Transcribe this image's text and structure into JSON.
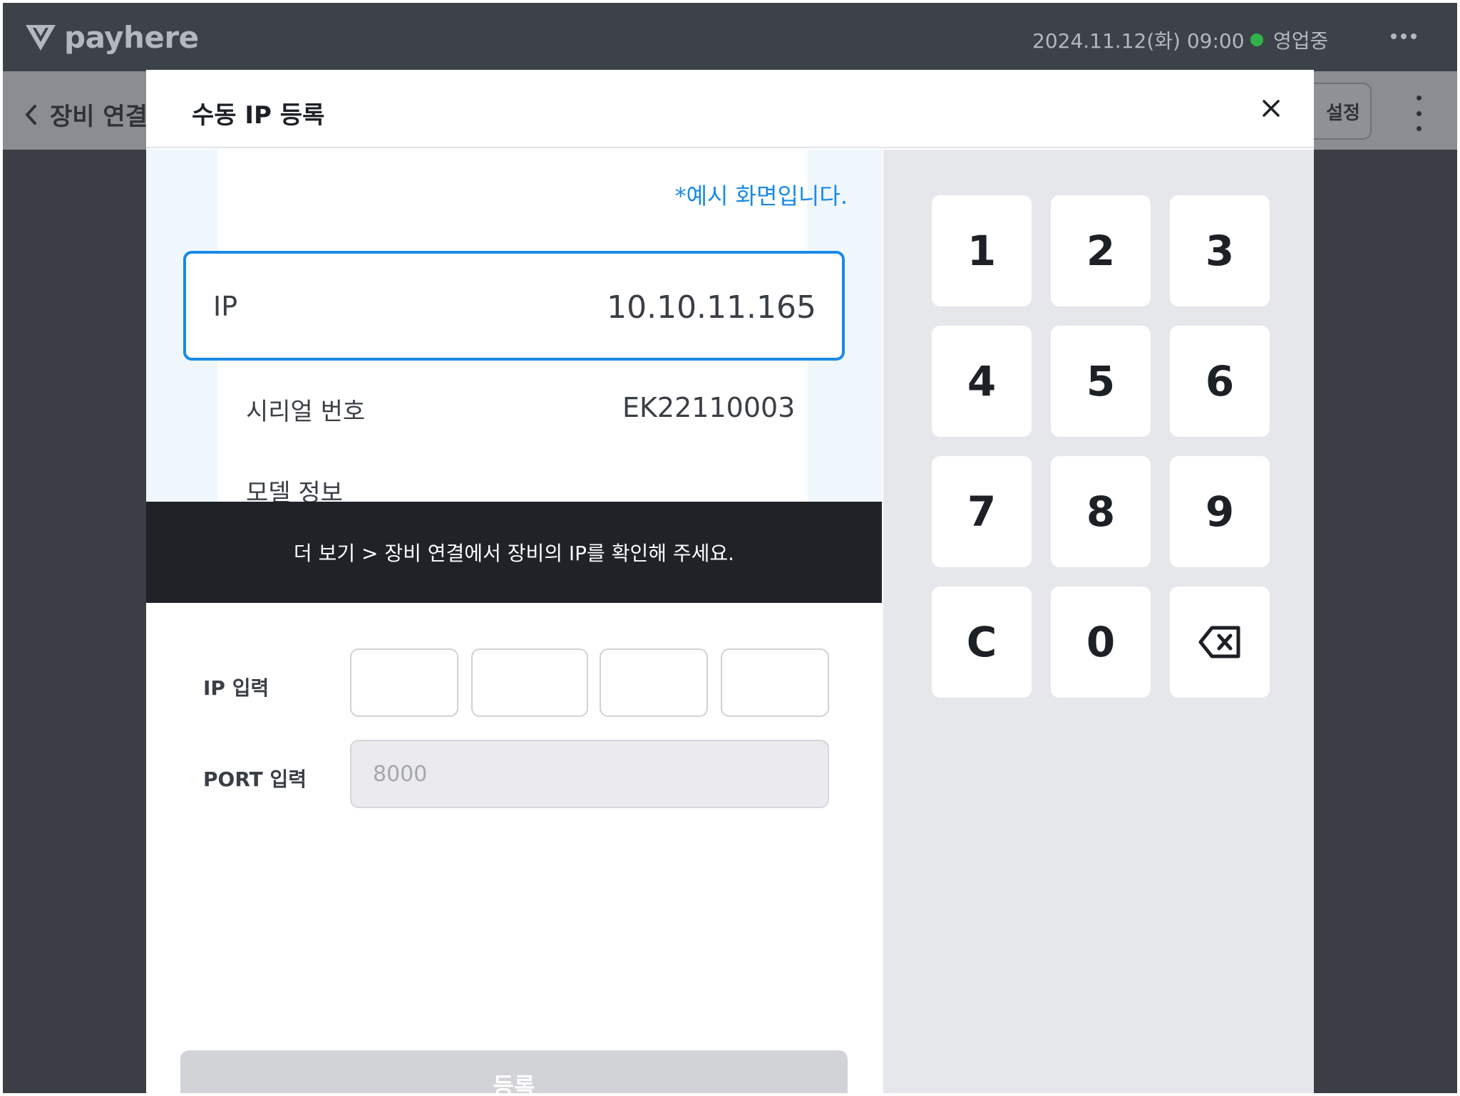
{
  "topbar": {
    "logo_text": "payhere",
    "datetime": "2024.11.12(화) 09:00",
    "status_text": "영업중",
    "status_color": "#2fb34a"
  },
  "subbar": {
    "back_label": "장비 연결",
    "settings_label": "설정"
  },
  "modal": {
    "title": "수동 IP 등록",
    "close_icon": "close-icon",
    "example": {
      "note": "*예시 화면입니다.",
      "ip_label": "IP",
      "ip_value": "10.10.11.165",
      "serial_label": "시리얼 번호",
      "serial_value": "EK22110003",
      "model_label": "모델 정보"
    },
    "tooltip": "더 보기 > 장비 연결에서 장비의 IP를 확인해 주세요.",
    "form": {
      "ip_label": "IP 입력",
      "ip_segments": [
        "",
        "",
        "",
        ""
      ],
      "port_label": "PORT 입력",
      "port_placeholder": "8000"
    },
    "register_label": "등록",
    "accent_color": "#1a8ae5"
  },
  "keypad": {
    "keys": [
      "1",
      "2",
      "3",
      "4",
      "5",
      "6",
      "7",
      "8",
      "9",
      "C",
      "0"
    ],
    "backspace_icon": "backspace-icon"
  }
}
